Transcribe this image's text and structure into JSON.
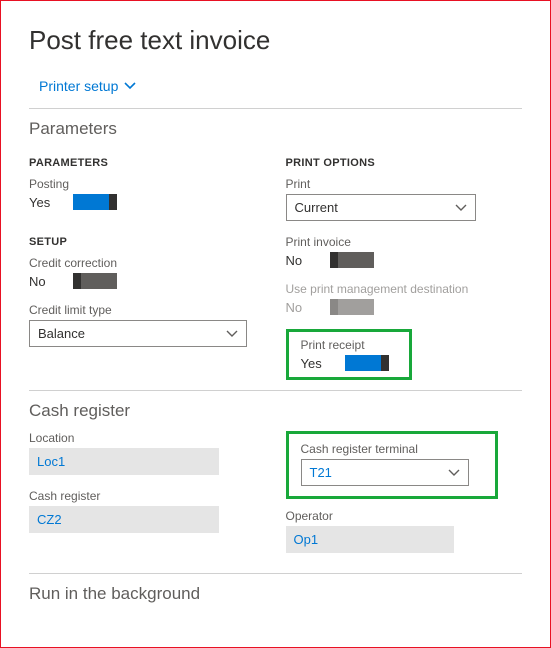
{
  "pageTitle": "Post free text invoice",
  "printerSetupLabel": "Printer setup",
  "parameters": {
    "sectionTitle": "Parameters",
    "left": {
      "parametersHead": "PARAMETERS",
      "posting": {
        "label": "Posting",
        "value": "Yes"
      },
      "setupHead": "SETUP",
      "creditCorrection": {
        "label": "Credit correction",
        "value": "No"
      },
      "creditLimitType": {
        "label": "Credit limit type",
        "value": "Balance"
      }
    },
    "right": {
      "printOptionsHead": "PRINT OPTIONS",
      "print": {
        "label": "Print",
        "value": "Current"
      },
      "printInvoice": {
        "label": "Print invoice",
        "value": "No"
      },
      "usePrintMgmt": {
        "label": "Use print management destination",
        "value": "No"
      },
      "printReceipt": {
        "label": "Print receipt",
        "value": "Yes"
      }
    }
  },
  "cashRegister": {
    "sectionTitle": "Cash register",
    "location": {
      "label": "Location",
      "value": "Loc1"
    },
    "cashRegister": {
      "label": "Cash register",
      "value": "CZ2"
    },
    "terminal": {
      "label": "Cash register terminal",
      "value": "T21"
    },
    "operator": {
      "label": "Operator",
      "value": "Op1"
    }
  },
  "background": {
    "sectionTitle": "Run in the background"
  }
}
